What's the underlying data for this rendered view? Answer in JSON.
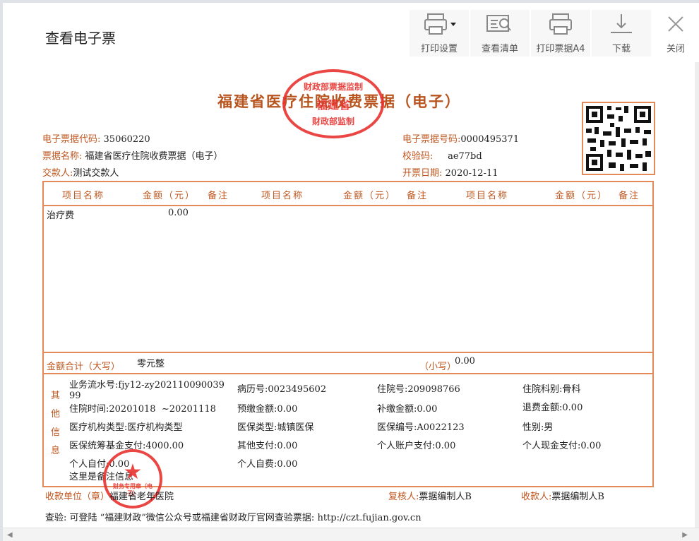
{
  "dialog": {
    "title": "查看电子票",
    "toolbar": [
      {
        "label": "打印设置",
        "icon": "printer-settings-icon"
      },
      {
        "label": "查看清单",
        "icon": "list-view-icon"
      },
      {
        "label": "打印票据A4",
        "icon": "printer-icon"
      },
      {
        "label": "下载",
        "icon": "download-icon"
      },
      {
        "label": "关闭",
        "icon": "close-icon"
      }
    ]
  },
  "receipt": {
    "title": "福建省医疗住院收费票据（电子）",
    "code_label": "电子票据代码:",
    "code": "35060220",
    "name_label": "票据名称:",
    "name": "福建省医疗住院收费票据（电子）",
    "payer_label": "交款人:",
    "payer": "测试交款人",
    "number_label": "电子票据号码:",
    "number": "0000495371",
    "check_label": "校验码:",
    "check": "ae77bd",
    "date_label": "开票日期:",
    "date": "2020-12-11",
    "table_headers": [
      "项目名称",
      "金额（元）",
      "备注",
      "项目名称",
      "金额（元）",
      "备注",
      "项目名称",
      "金额（元）",
      "备注"
    ],
    "items": [
      {
        "name": "治疗费",
        "amount": "0.00"
      }
    ],
    "total_label": "金额合计（大写）",
    "total_upper": "零元整",
    "total_lower_label": "（小写）",
    "total_lower": "0.00",
    "other_label": "其他信息",
    "other": {
      "serial_label": "业务流水号:",
      "serial": "fjy12-zy20211009003999",
      "record_label": "病历号:",
      "record": "0023495602",
      "inpatient_label": "住院号:",
      "inpatient": "209098766",
      "dept_label": "住院科别:",
      "dept": "骨科",
      "period_label": "住院时间:",
      "period": "20201018  ~20201118",
      "prepaid_label": "预缴金额:",
      "prepaid": "0.00",
      "supplement_label": "补缴金额:",
      "supplement": "0.00",
      "refund_label": "退费金额:",
      "refund": "0.00",
      "org_type_label": "医疗机构类型:",
      "org_type": "医疗机构类型",
      "ins_type_label": "医保类型:",
      "ins_type": "城镇医保",
      "ins_no_label": "医保编号:",
      "ins_no": "A0022123",
      "gender_label": "性别:",
      "gender": "男",
      "fund_label": "医保统筹基金支付:",
      "fund": "4000.00",
      "other_pay_label": "其他支付:",
      "other_pay": "0.00",
      "acct_label": "个人账户支付:",
      "acct": "0.00",
      "cash_label": "个人现金支付:",
      "cash": "0.00",
      "self_pay_label": "个人自付:",
      "self_pay": "0.00",
      "self_cost_label": "个人自费:",
      "self_cost": "0.00",
      "note": "这里是备注信息"
    },
    "payee_unit_label": "收款单位（章）",
    "payee_unit": "福建省老年医院",
    "reviewer_label": "复核人:",
    "reviewer": "票据编制人B",
    "collector_label": "收款人:",
    "collector": "票据编制人B",
    "verify": "查验: 可登陆 “福建财政”微信公众号或福建省财政厅官网查验票据: http://czt.fujian.gov.cn",
    "stamp_top": "财政部票据监制",
    "stamp_mid": "福建省",
    "stamp_bottom": "财政部监制",
    "hospital_stamp": "财务专用章（电子）"
  },
  "colors": {
    "accent": "#c0561f",
    "border": "#e38a58",
    "stamp": "#e8322f"
  }
}
